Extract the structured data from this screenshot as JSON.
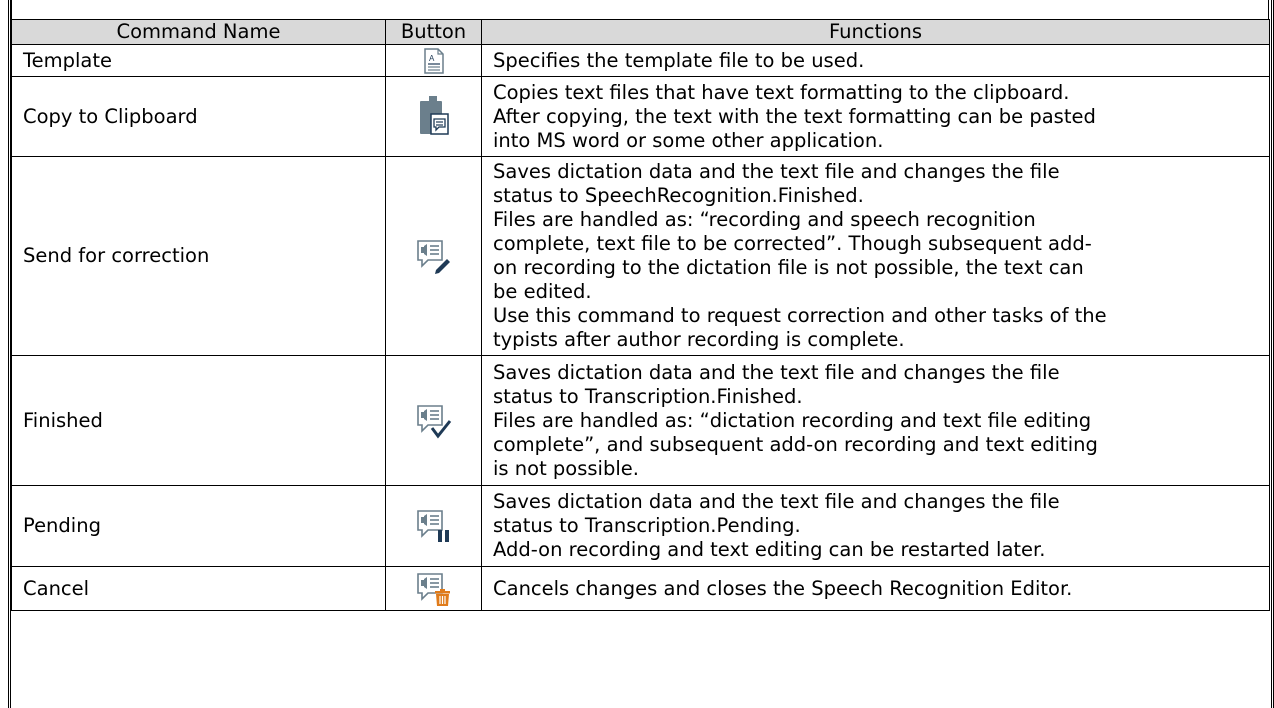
{
  "table": {
    "headers": [
      "Command Name",
      "Button",
      "Functions"
    ],
    "header_bg": "#d9d9d9",
    "rows": [
      {
        "name": "Template",
        "icon": "template-icon",
        "func": [
          "Specifies the template file to be used."
        ]
      },
      {
        "name": "Copy to Clipboard",
        "icon": "copy-to-clipboard-icon",
        "func": [
          "Copies text files that have text formatting to the clipboard.",
          "After copying, the text with the text formatting can be pasted",
          "into MS word or some other application."
        ]
      },
      {
        "name": "Send for correction",
        "icon": "send-for-correction-icon",
        "func": [
          "Saves dictation data and the text file and changes the file",
          "status to SpeechRecognition.Finished.",
          "Files are handled as: “recording and speech recognition",
          "complete, text file to be corrected”. Though subsequent add-",
          "on recording to the dictation file is not possible, the text can",
          "be edited.",
          "Use this command to request correction and other tasks of the",
          "typists after author recording is complete."
        ]
      },
      {
        "name": "Finished",
        "icon": "finished-icon",
        "func": [
          "Saves dictation data and the text file and changes the file",
          "status to Transcription.Finished.",
          "Files are handled as: “dictation recording and text file editing",
          "complete”, and subsequent add-on recording and text editing",
          "is not possible."
        ]
      },
      {
        "name": "Pending",
        "icon": "pending-icon",
        "func": [
          "Saves dictation data and the text file and changes the file",
          "status to Transcription.Pending.",
          "Add-on recording and text editing can be restarted later."
        ]
      },
      {
        "name": "Cancel",
        "icon": "cancel-icon",
        "func": [
          "Cancels changes and closes the Speech Recognition Editor."
        ]
      }
    ]
  },
  "colors": {
    "icon_gray": "#6b7f8c",
    "icon_dark": "#1f3a56",
    "icon_check": "#1f3a56",
    "icon_trash": "#e07b1a"
  }
}
